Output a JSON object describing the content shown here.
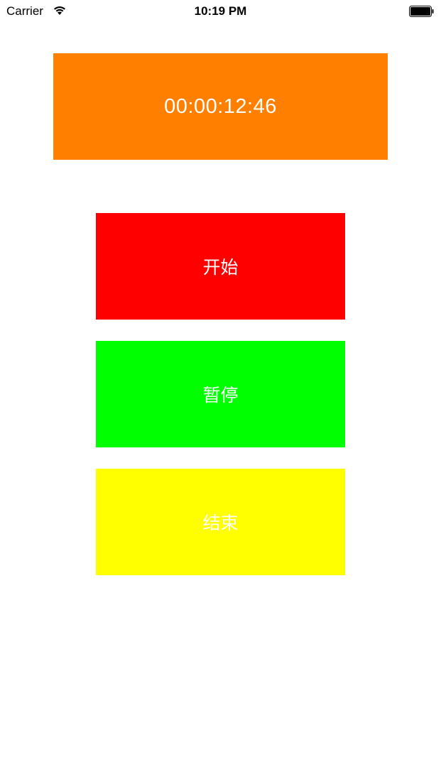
{
  "status_bar": {
    "carrier": "Carrier",
    "time": "10:19 PM"
  },
  "timer": {
    "display": "00:00:12:46",
    "background": "#FF8000"
  },
  "buttons": {
    "start": {
      "label": "开始",
      "background": "#FF0000"
    },
    "pause": {
      "label": "暂停",
      "background": "#00FF00"
    },
    "stop": {
      "label": "结束",
      "background": "#FFFF00"
    }
  },
  "icons": {
    "wifi": "wifi-icon",
    "battery": "battery-icon"
  }
}
